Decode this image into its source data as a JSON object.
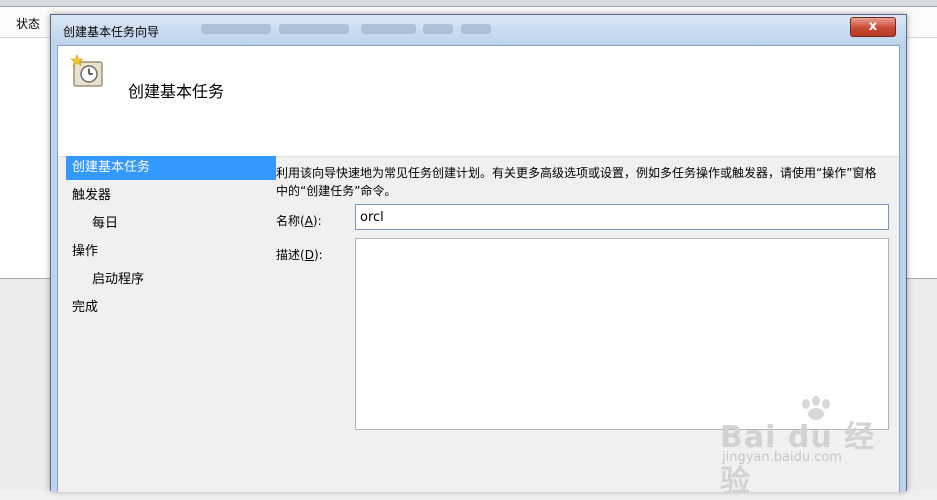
{
  "background": {
    "status_header": "状态"
  },
  "dialog": {
    "title": "创建基本任务向导",
    "close_glyph": "x"
  },
  "header": {
    "title": "创建基本任务"
  },
  "nav": {
    "items": [
      {
        "label": "创建基本任务"
      },
      {
        "label": "触发器"
      },
      {
        "label": "每日"
      },
      {
        "label": "操作"
      },
      {
        "label": "启动程序"
      },
      {
        "label": "完成"
      }
    ]
  },
  "content": {
    "description": "利用该向导快速地为常见任务创建计划。有关更多高级选项或设置，例如多任务操作或触发器，请使用“操作”窗格中的“创建任务”命令。",
    "name_label_prefix": "名称(",
    "name_label_key": "A",
    "name_label_suffix": "):",
    "name_value": "orcl",
    "desc_label_prefix": "描述(",
    "desc_label_key": "D",
    "desc_label_suffix": "):",
    "desc_value": ""
  },
  "watermark": {
    "logo": "Bai du 经验",
    "url": "jingyan.baidu.com"
  },
  "colors": {
    "nav_active": "#3399ff",
    "close_button": "#c94a33",
    "titlebar": "#bcd2ec"
  }
}
